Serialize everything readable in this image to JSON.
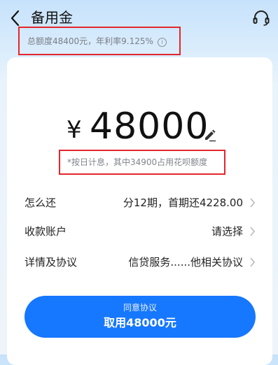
{
  "header": {
    "title": "备用金"
  },
  "quota": {
    "text": "总额度48400元，年利率9.125%",
    "info_glyph": "i"
  },
  "amount": {
    "currency": "¥",
    "value": "48000"
  },
  "note": {
    "text": "*按日计息，其中34900占用花呗额度"
  },
  "rows": [
    {
      "label": "怎么还",
      "value": "分12期，首期还4228.00"
    },
    {
      "label": "收款账户",
      "value": "请选择"
    },
    {
      "label": "详情及协议",
      "value": "信贷服务......他相关协议"
    }
  ],
  "cta": {
    "sub_label": "同意协议",
    "main_label": "取用48000元"
  },
  "colors": {
    "accent": "#1677ff",
    "highlight_border": "#e3262c"
  },
  "icons": [
    "back-arrow-icon",
    "headset-icon",
    "info-icon",
    "edit-pencil-icon",
    "chevron-right-icon"
  ]
}
